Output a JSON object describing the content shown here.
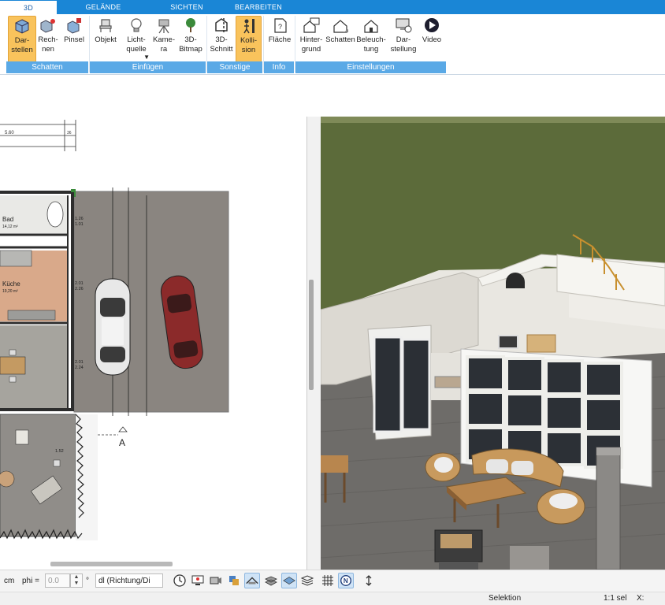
{
  "tabs": [
    {
      "label": "3D",
      "active": true
    },
    {
      "label": "GELÄNDE"
    },
    {
      "label": "SICHTEN"
    },
    {
      "label": "BEARBEITEN"
    }
  ],
  "ribbon": {
    "darstellen": "Dar-\nstellen",
    "rechnen": "Rech-\nnen",
    "pinsel": "Pinsel",
    "objekt": "Objekt",
    "lichtquelle": "Licht-\nquelle",
    "kamera": "Kame-\nra",
    "bitmap3d": "3D-\nBitmap",
    "schnitt3d": "3D-\nSchnitt",
    "kollision": "Kolli-\nsion",
    "flaeche": "Fläche",
    "hintergrund": "Hinter-\ngrund",
    "schatten": "Schatten",
    "beleuchtung": "Beleuch-\ntung",
    "darstellung": "Dar-\nstellung",
    "video": "Video"
  },
  "groups": {
    "schatten": "Schatten",
    "einfuegen": "Einfügen",
    "sonstige": "Sonstige",
    "info": "Info",
    "einstellungen": "Einstellungen"
  },
  "plan": {
    "dim_top": "5.60",
    "dim_top_small": "36",
    "room_bad": "Bad",
    "room_bad_area": "14,12 m²",
    "room_kueche": "Küche",
    "room_kueche_area": "19,20 m²",
    "dim_a": "1.26",
    "dim_b": "1.01",
    "dim_c": "2.01",
    "dim_d": "2.26",
    "dim_e": "2.01",
    "dim_f": "2.24",
    "dim_g": "1.52",
    "section_label": "A"
  },
  "toolbar": {
    "unit": "cm",
    "phi_label": "phi =",
    "phi_value": "0.0",
    "degree": "°",
    "direction_select": "dl (Richtung/Di"
  },
  "status": {
    "mode": "Selektion",
    "scale": "1:1 sel",
    "x_label": "X:"
  },
  "colors": {
    "tab_bar": "#1a86d6",
    "group_bar": "#5aa9e6",
    "active_button": "#f9c35c"
  }
}
